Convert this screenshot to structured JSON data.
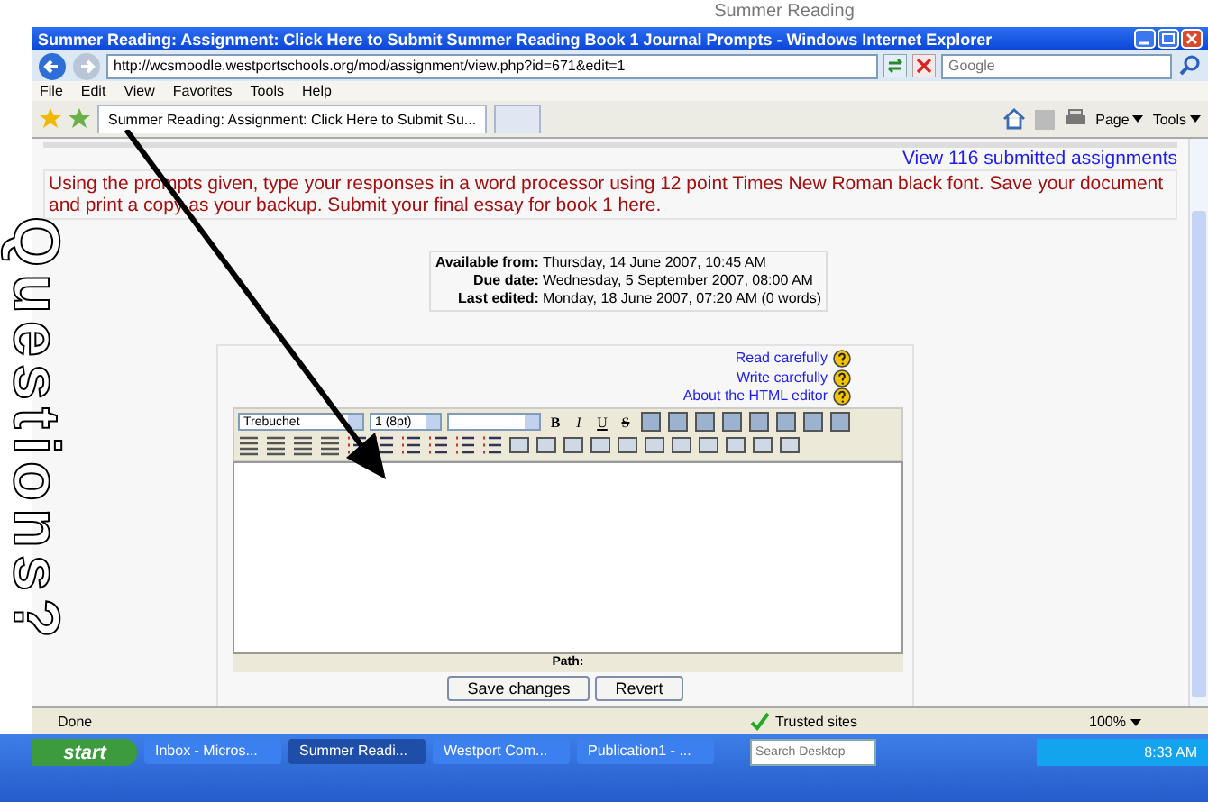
{
  "annotation": {
    "caption": "Summer Reading",
    "side_text": "Questions?"
  },
  "window": {
    "title": "Summer Reading: Assignment: Click Here to Submit Summer Reading Book 1 Journal Prompts - Windows Internet Explorer"
  },
  "address_bar": {
    "url": "http://wcsmoodle.westportschools.org/mod/assignment/view.php?id=671&edit=1",
    "search_placeholder": "Google"
  },
  "menu": [
    "File",
    "Edit",
    "View",
    "Favorites",
    "Tools",
    "Help"
  ],
  "tabs": [
    {
      "label": "Summer Reading: Assignment: Click Here to Submit Su...",
      "selected": true
    },
    {
      "selected": false
    }
  ],
  "command_bar": [
    "Page",
    "Tools"
  ],
  "page": {
    "submissions_link": "View 116 submitted assignments",
    "instructions": "Using the prompts given, type your responses in a word processor using 12 point Times New Roman black font. Save your document and print a copy as your backup. Submit your final essay for book 1 here.",
    "dates": [
      {
        "label": "Available from:",
        "value": "Thursday, 14 June 2007, 10:45 AM"
      },
      {
        "label": "Due date:",
        "value": "Wednesday, 5 September 2007, 08:00 AM"
      },
      {
        "label": "Last edited:",
        "value": "Monday, 18 June 2007, 07:20 AM (0 words)"
      }
    ],
    "help_links": [
      "Read carefully",
      "Write carefully",
      "About the HTML editor"
    ],
    "editor": {
      "font": "Trebuchet",
      "size": "1 (8pt)",
      "format_buttons": [
        "B",
        "I",
        "U",
        "S"
      ],
      "path_label": "Path:"
    },
    "buttons": [
      "Save changes",
      "Revert"
    ]
  },
  "status_bar": {
    "text": "Done",
    "zone": "Trusted sites",
    "zoom": "100%"
  },
  "taskbar": {
    "start": "start",
    "items": [
      {
        "label": "Inbox - Micros...",
        "selected": false
      },
      {
        "label": "Summer Readi...",
        "selected": true
      },
      {
        "label": "Westport Com...",
        "selected": false
      },
      {
        "label": "Publication1 - ...",
        "selected": false
      }
    ],
    "search_placeholder": "Search Desktop",
    "clock": "8:33 AM"
  }
}
